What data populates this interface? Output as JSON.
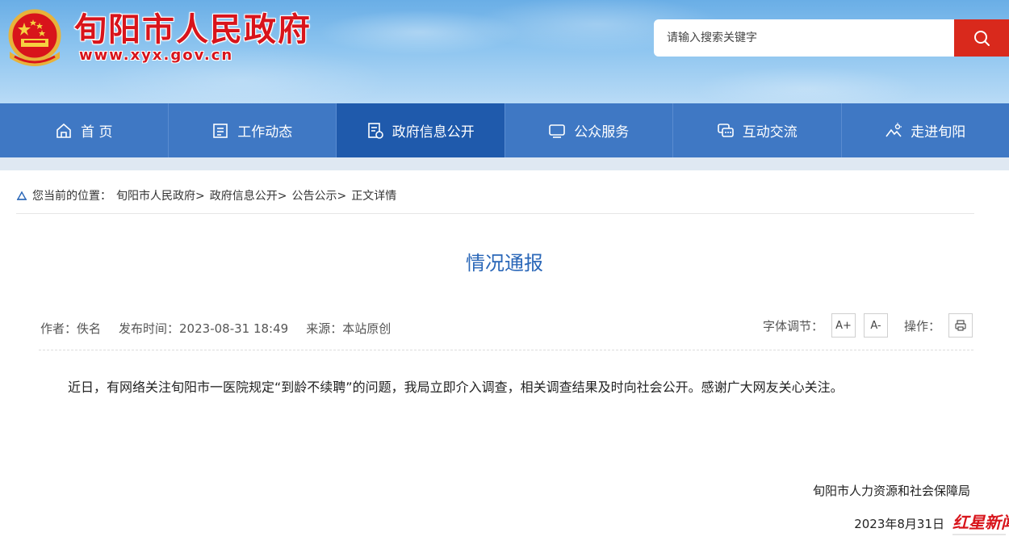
{
  "header": {
    "site_title": "旬阳市人民政府",
    "site_url": "www.xyx.gov.cn",
    "search_placeholder": "请输入搜索关键字"
  },
  "nav": {
    "items": [
      {
        "label": "首 页",
        "icon": "home-icon"
      },
      {
        "label": "工作动态",
        "icon": "document-list-icon"
      },
      {
        "label": "政府信息公开",
        "icon": "file-info-icon",
        "active": true
      },
      {
        "label": "公众服务",
        "icon": "monitor-icon"
      },
      {
        "label": "互动交流",
        "icon": "chat-icon"
      },
      {
        "label": "走进旬阳",
        "icon": "landscape-icon"
      }
    ]
  },
  "breadcrumb": {
    "prefix": "您当前的位置：",
    "items": [
      "旬阳市人民政府>",
      "政府信息公开>",
      "公告公示>",
      "正文详情"
    ]
  },
  "article": {
    "title": "情况通报",
    "meta": {
      "author": "作者：佚名",
      "publish_time": "发布时间：2023-08-31 18:49",
      "source": "来源：本站原创"
    },
    "tools": {
      "font_label": "字体调节：",
      "font_increase": "A+",
      "font_decrease": "A-",
      "ops_label": "操作："
    },
    "body": "近日，有网络关注旬阳市一医院规定“到龄不续聘”的问题，我局立即介入调查，相关调查结果及时向社会公开。感谢广大网友关心关注。",
    "signature": "旬阳市人力资源和社会保障局",
    "date": "2023年8月31日"
  },
  "watermark": {
    "text": "红星新闻"
  },
  "colors": {
    "brand_red": "#d8141b",
    "nav_blue": "#3f78c4",
    "nav_active": "#1f5aac",
    "title_blue": "#2a67b8",
    "search_red": "#d9291c"
  }
}
